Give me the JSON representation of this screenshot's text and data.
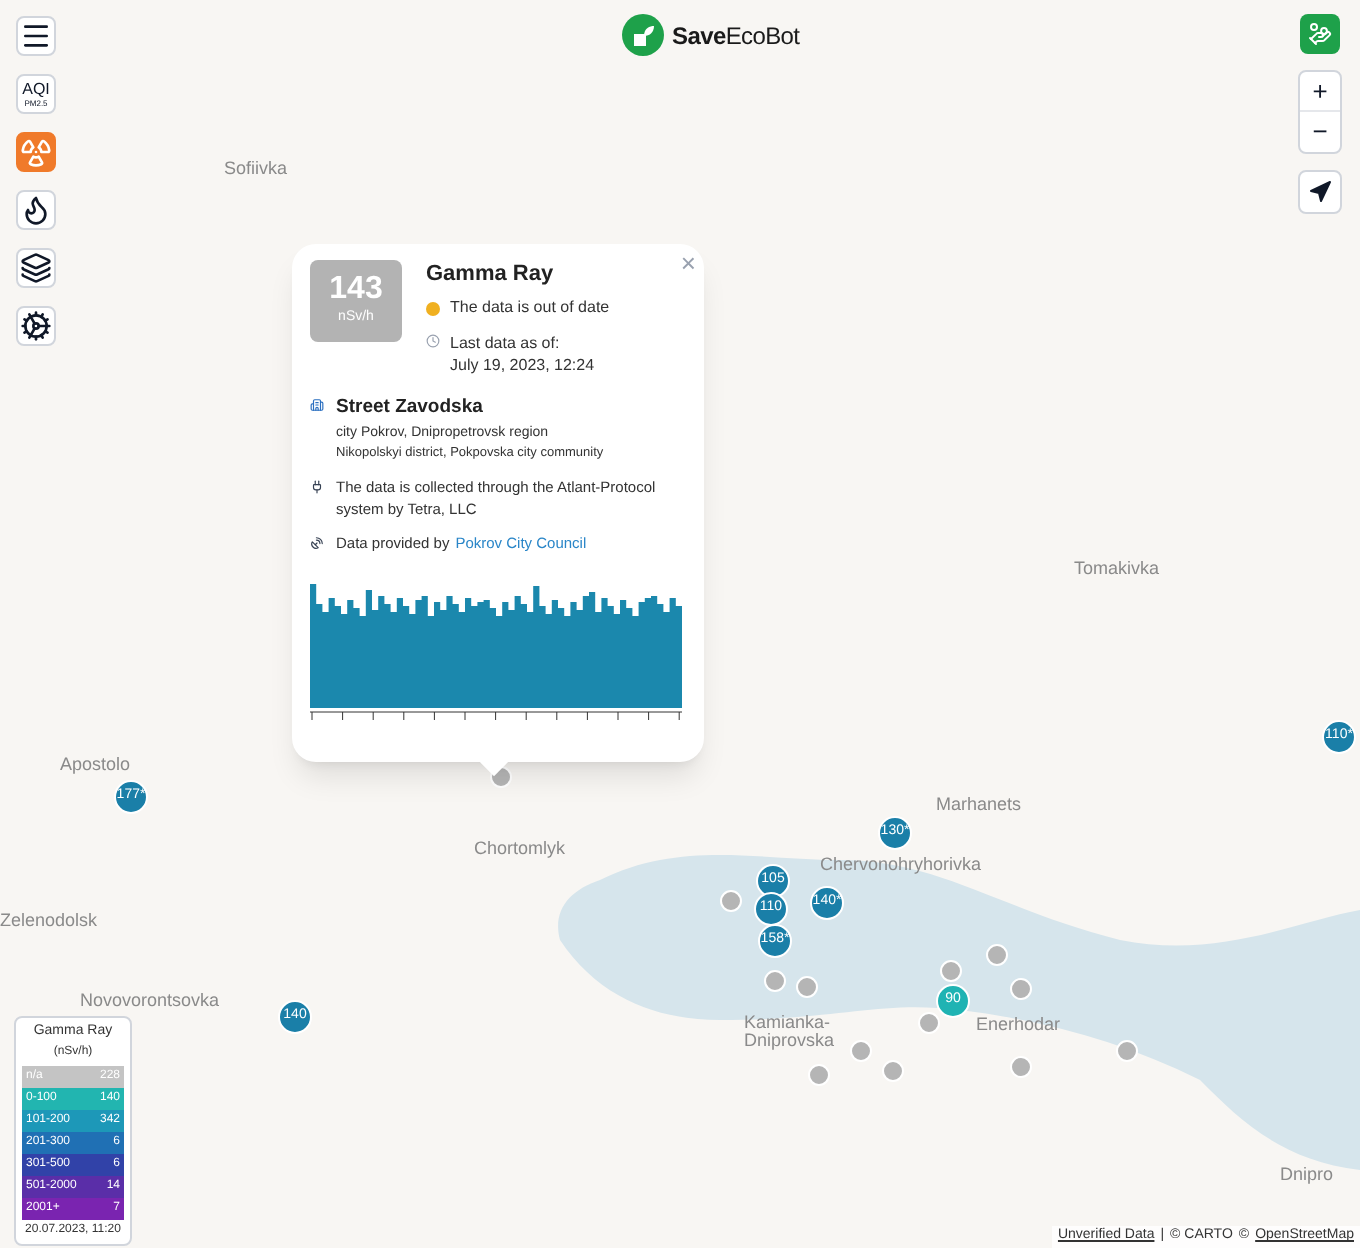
{
  "logo": {
    "brand_bold": "Save",
    "brand_rest": "EcoBot"
  },
  "left_toolbar": [
    {
      "kind": "menu",
      "selected": false
    },
    {
      "kind": "aqi",
      "label": "AQI",
      "sublabel": "PM2.5",
      "selected": false
    },
    {
      "kind": "radiation",
      "selected": true
    },
    {
      "kind": "fire",
      "selected": false
    },
    {
      "kind": "layers",
      "selected": false
    },
    {
      "kind": "settings",
      "selected": false
    }
  ],
  "right_controls": {
    "zoom_in": "+",
    "zoom_out": "−"
  },
  "map_labels": [
    "Sofiivka",
    "Tomakivka",
    "Apostolo",
    "Chortomlyk",
    "Marhanets",
    "Chervonohryhorivka",
    "Zelenodolsk",
    "Novovorontsovka",
    "Kamianka-",
    "Dniprovska",
    "Enerhodar",
    "Dnipro"
  ],
  "markers": [
    {
      "value": "177*",
      "color": "#1a7fa8"
    },
    {
      "value": "140",
      "color": "#1a7fa8"
    },
    {
      "value": "105",
      "color": "#1a7fa8"
    },
    {
      "value": "110",
      "color": "#1a7fa8"
    },
    {
      "value": "140*",
      "color": "#1a7fa8"
    },
    {
      "value": "158*",
      "color": "#1a7fa8"
    },
    {
      "value": "130*",
      "color": "#1a7fa8"
    },
    {
      "value": "110*",
      "color": "#1a7fa8"
    },
    {
      "value": "90",
      "color": "#1fb3b3"
    }
  ],
  "popup": {
    "value": "143",
    "unit": "nSv/h",
    "title": "Gamma Ray",
    "status": "The data is out of date",
    "last_label": "Last data as of:",
    "last_date": "July 19, 2023, 12:24",
    "street": "Street Zavodska",
    "address_1": "city Pokrov, Dnipropetrovsk region",
    "address_2": "Nikopolskyi district, Pokpovska city community",
    "collected": "The data is collected through the Atlant-Protocol system by Tetra, LLC",
    "provided_prefix": "Data provided by",
    "provider": "Pokrov City Council",
    "close": "×"
  },
  "legend": {
    "title": "Gamma Ray",
    "unit": "(nSv/h)",
    "rows": [
      {
        "range": "n/a",
        "count": "228",
        "color": "#c4c4c4"
      },
      {
        "range": "0-100",
        "count": "140",
        "color": "#22b5b0"
      },
      {
        "range": "101-200",
        "count": "342",
        "color": "#1d98b8"
      },
      {
        "range": "201-300",
        "count": "6",
        "color": "#2070b4"
      },
      {
        "range": "301-500",
        "count": "6",
        "color": "#3142a8"
      },
      {
        "range": "501-2000",
        "count": "14",
        "color": "#5a2ea8"
      },
      {
        "range": "2001+",
        "count": "7",
        "color": "#7a24b0"
      }
    ],
    "updated": "20.07.2023, 11:20"
  },
  "attribution": {
    "unverified": "Unverified Data",
    "separator": "|",
    "carto": "© CARTO",
    "osm_prefix": "©",
    "osm": "OpenStreetMap"
  }
}
